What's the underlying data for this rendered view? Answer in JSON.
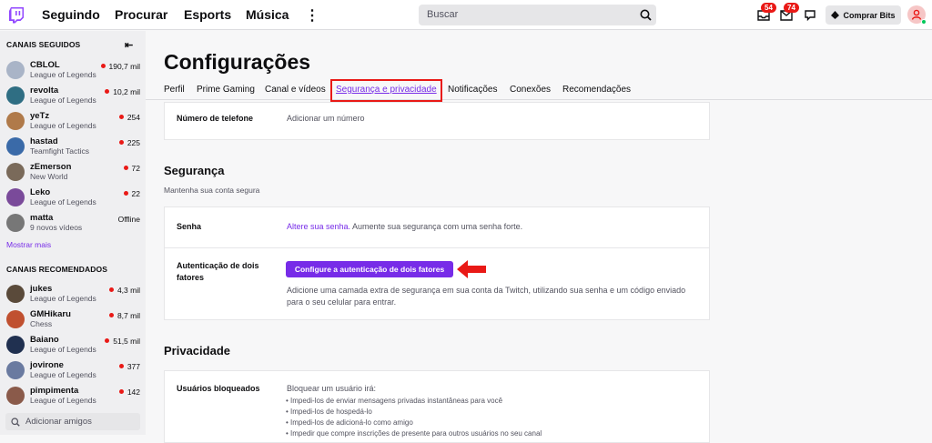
{
  "topnav": {
    "links": [
      "Seguindo",
      "Procurar",
      "Esports",
      "Música"
    ],
    "search_placeholder": "Buscar",
    "notif_badge_1": "54",
    "notif_badge_2": "74",
    "bits_label": "Comprar Bits"
  },
  "sidebar": {
    "followed_heading": "CANAIS SEGUIDOS",
    "followed": [
      {
        "name": "CBLOL",
        "game": "League of Legends",
        "viewers": "190,7 mil",
        "live": true,
        "color": "#a9b4c7"
      },
      {
        "name": "revolta",
        "game": "League of Legends",
        "viewers": "10,2 mil",
        "live": true,
        "color": "#2f6e83"
      },
      {
        "name": "yeTz",
        "game": "League of Legends",
        "viewers": "254",
        "live": true,
        "color": "#b07a4a"
      },
      {
        "name": "hastad",
        "game": "Teamfight Tactics",
        "viewers": "225",
        "live": true,
        "color": "#3a6aa8"
      },
      {
        "name": "zEmerson",
        "game": "New World",
        "viewers": "72",
        "live": true,
        "color": "#7a6a5a"
      },
      {
        "name": "Leko",
        "game": "League of Legends",
        "viewers": "22",
        "live": true,
        "color": "#7a4a9a"
      },
      {
        "name": "matta",
        "game": "9 novos vídeos",
        "viewers": "Offline",
        "live": false,
        "color": "#777777"
      }
    ],
    "show_more": "Mostrar mais",
    "recommended_heading": "CANAIS RECOMENDADOS",
    "recommended": [
      {
        "name": "jukes",
        "game": "League of Legends",
        "viewers": "4,3 mil",
        "live": true,
        "color": "#5a4a3a"
      },
      {
        "name": "GMHikaru",
        "game": "Chess",
        "viewers": "8,7 mil",
        "live": true,
        "color": "#c05030"
      },
      {
        "name": "Baiano",
        "game": "League of Legends",
        "viewers": "51,5 mil",
        "live": true,
        "color": "#203050"
      },
      {
        "name": "jovirone",
        "game": "League of Legends",
        "viewers": "377",
        "live": true,
        "color": "#6a7aa0"
      },
      {
        "name": "pimpimenta",
        "game": "League of Legends",
        "viewers": "142",
        "live": true,
        "color": "#8a5a4a"
      }
    ],
    "add_friends": "Adicionar amigos"
  },
  "main": {
    "title": "Configurações",
    "tabs": [
      "Perfil",
      "Prime Gaming",
      "Canal e vídeos",
      "Segurança e privacidade",
      "Notificações",
      "Conexões",
      "Recomendações"
    ],
    "phone_label": "Número de telefone",
    "phone_link": "Adicionar um número",
    "security_title": "Segurança",
    "security_sub": "Mantenha sua conta segura",
    "password_label": "Senha",
    "password_link": "Altere sua senha.",
    "password_text": " Aumente sua segurança com uma senha forte.",
    "twofa_label_1": "Autenticação de dois",
    "twofa_label_2": "fatores",
    "twofa_button": "Configure a autenticação de dois fatores",
    "twofa_desc_1": "Adicione uma camada extra de segurança em sua conta da Twitch, utilizando sua senha e um código enviado",
    "twofa_desc_2": "para o seu celular para entrar.",
    "privacy_title": "Privacidade",
    "blocked_label": "Usuários bloqueados",
    "blocked_intro": "Bloquear um usuário irá:",
    "blocked_bullets": [
      "Impedi-los de enviar mensagens privadas instantâneas para você",
      "Impedi-los de hospedá-lo",
      "Impedi-los de adicioná-lo como amigo",
      "Impedir que compre inscrições de presente para outros usuários no seu canal"
    ]
  },
  "colors": {
    "accent": "#772ce8",
    "live": "#e91916"
  }
}
